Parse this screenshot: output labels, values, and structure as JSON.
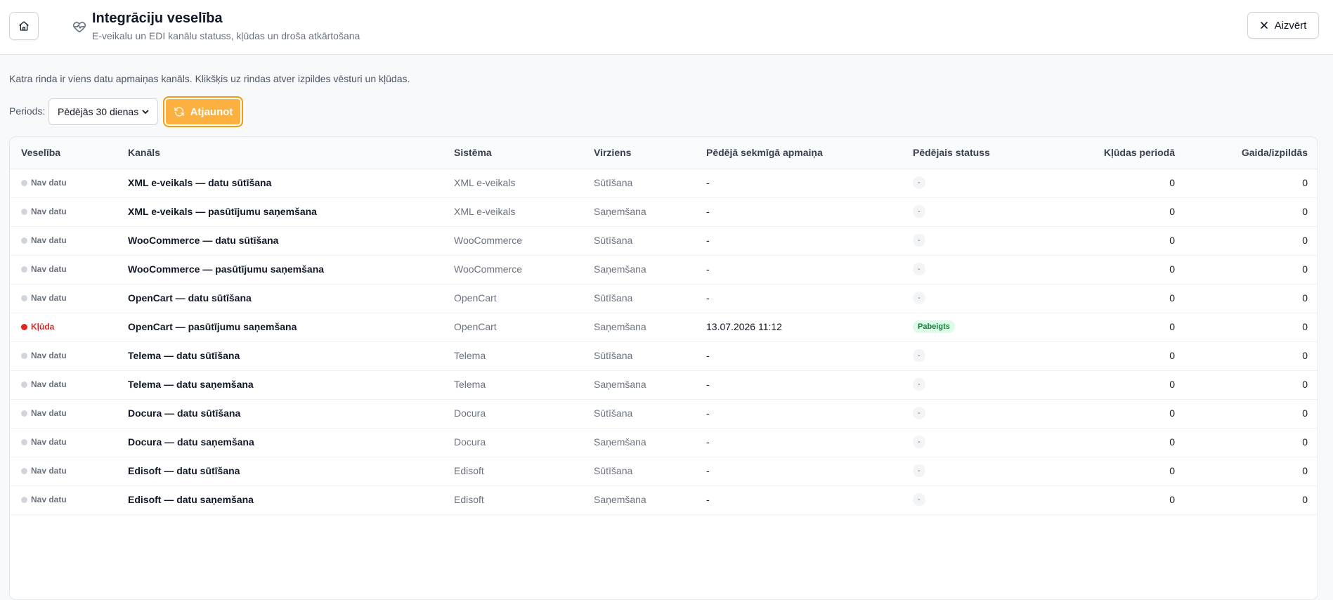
{
  "header": {
    "title": "Integrāciju veselība",
    "subtitle": "E-veikalu un EDI kanālu statuss, kļūdas un droša atkārtošana",
    "close_label": "Aizvērt",
    "icons": {
      "home": "home-icon",
      "title": "heart-pulse-icon",
      "close": "close-icon"
    }
  },
  "intro": "Katra rinda ir viens datu apmaiņas kanāls. Klikšķis uz rindas atver izpildes vēsturi un kļūdas.",
  "filters": {
    "period_label": "Periods:",
    "period_value": "Pēdējās 30 dienas",
    "refresh_label": "Atjaunot"
  },
  "colors": {
    "accent": "#fbb040",
    "error": "#dc2626",
    "success_bg": "#dcfce7",
    "success_text": "#15803d"
  },
  "table": {
    "columns": [
      "Veselība",
      "Kanāls",
      "Sistēma",
      "Virziens",
      "Pēdējā sekmīgā apmaiņa",
      "Pēdējais statuss",
      "Kļūdas periodā",
      "Gaida/izpildās"
    ],
    "rows": [
      {
        "health": "Nav datu",
        "channel": "XML e-veikals — datu sūtīšana",
        "system": "XML e-veikals",
        "direction": "Sūtīšana",
        "last_ok": "-",
        "status": "-",
        "errors": "0",
        "pending": "0"
      },
      {
        "health": "Nav datu",
        "channel": "XML e-veikals — pasūtījumu saņemšana",
        "system": "XML e-veikals",
        "direction": "Saņemšana",
        "last_ok": "-",
        "status": "-",
        "errors": "0",
        "pending": "0"
      },
      {
        "health": "Nav datu",
        "channel": "WooCommerce — datu sūtīšana",
        "system": "WooCommerce",
        "direction": "Sūtīšana",
        "last_ok": "-",
        "status": "-",
        "errors": "0",
        "pending": "0"
      },
      {
        "health": "Nav datu",
        "channel": "WooCommerce — pasūtījumu saņemšana",
        "system": "WooCommerce",
        "direction": "Saņemšana",
        "last_ok": "-",
        "status": "-",
        "errors": "0",
        "pending": "0"
      },
      {
        "health": "Nav datu",
        "channel": "OpenCart — datu sūtīšana",
        "system": "OpenCart",
        "direction": "Sūtīšana",
        "last_ok": "-",
        "status": "-",
        "errors": "0",
        "pending": "0"
      },
      {
        "health": "Kļūda",
        "channel": "OpenCart — pasūtījumu saņemšana",
        "system": "OpenCart",
        "direction": "Saņemšana",
        "last_ok": "13.07.2026 11:12",
        "status": "Pabeigts",
        "errors": "0",
        "pending": "0"
      },
      {
        "health": "Nav datu",
        "channel": "Telema — datu sūtīšana",
        "system": "Telema",
        "direction": "Sūtīšana",
        "last_ok": "-",
        "status": "-",
        "errors": "0",
        "pending": "0"
      },
      {
        "health": "Nav datu",
        "channel": "Telema — datu saņemšana",
        "system": "Telema",
        "direction": "Saņemšana",
        "last_ok": "-",
        "status": "-",
        "errors": "0",
        "pending": "0"
      },
      {
        "health": "Nav datu",
        "channel": "Docura — datu sūtīšana",
        "system": "Docura",
        "direction": "Sūtīšana",
        "last_ok": "-",
        "status": "-",
        "errors": "0",
        "pending": "0"
      },
      {
        "health": "Nav datu",
        "channel": "Docura — datu saņemšana",
        "system": "Docura",
        "direction": "Saņemšana",
        "last_ok": "-",
        "status": "-",
        "errors": "0",
        "pending": "0"
      },
      {
        "health": "Nav datu",
        "channel": "Edisoft — datu sūtīšana",
        "system": "Edisoft",
        "direction": "Sūtīšana",
        "last_ok": "-",
        "status": "-",
        "errors": "0",
        "pending": "0"
      },
      {
        "health": "Nav datu",
        "channel": "Edisoft — datu saņemšana",
        "system": "Edisoft",
        "direction": "Saņemšana",
        "last_ok": "-",
        "status": "-",
        "errors": "0",
        "pending": "0"
      }
    ]
  }
}
